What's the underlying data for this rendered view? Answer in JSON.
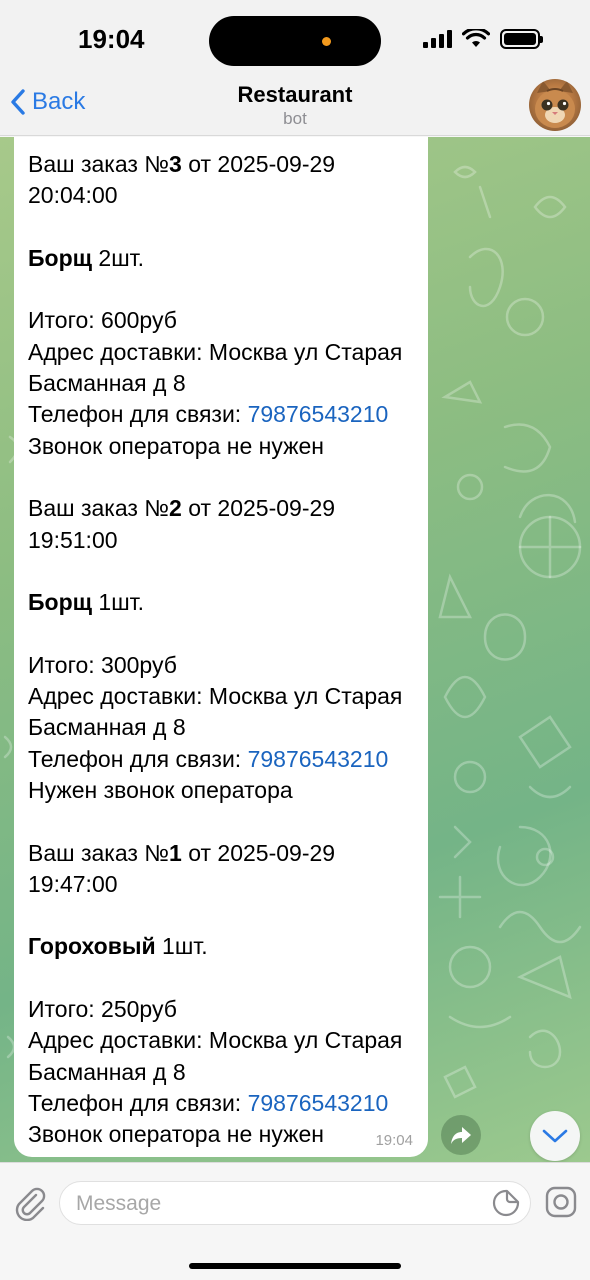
{
  "status_bar": {
    "time": "19:04"
  },
  "header": {
    "back_label": "Back",
    "title": "Restaurant",
    "subtitle": "bot",
    "avatar": "cat-avatar"
  },
  "message": {
    "orders": [
      {
        "prefix": "Ваш заказ №",
        "number": "3",
        "date_suffix": " от 2025-09-29",
        "time": "20:04:00",
        "dish": "Борщ",
        "qty": " 2шт.",
        "total": "Итого: 600руб",
        "address_1": "Адрес доставки: Москва ул Старая",
        "address_2": "Басманная д 8",
        "phone_label": "Телефон для связи: ",
        "phone": "79876543210",
        "operator_note": "Звонок оператора не нужен"
      },
      {
        "prefix": "Ваш заказ №",
        "number": "2",
        "date_suffix": " от 2025-09-29",
        "time": "19:51:00",
        "dish": "Борщ",
        "qty": " 1шт.",
        "total": "Итого: 300руб",
        "address_1": "Адрес доставки: Москва ул Старая",
        "address_2": "Басманная д 8",
        "phone_label": "Телефон для связи: ",
        "phone": "79876543210",
        "operator_note": "Нужен звонок оператора"
      },
      {
        "prefix": "Ваш заказ №",
        "number": "1",
        "date_suffix": " от 2025-09-29",
        "time": "19:47:00",
        "dish": "Гороховый",
        "qty": " 1шт.",
        "total": "Итого: 250руб",
        "address_1": "Адрес доставки: Москва ул Старая",
        "address_2": "Басманная д 8",
        "phone_label": "Телефон для связи: ",
        "phone": "79876543210",
        "operator_note": "Звонок оператора не нужен"
      }
    ],
    "timestamp": "19:04"
  },
  "input": {
    "placeholder": "Message"
  },
  "icons": {
    "back": "chevron-left-icon",
    "forward": "forward-arrow-icon",
    "scroll_down": "chevron-down-icon",
    "attach": "paperclip-icon",
    "sticker": "sticker-icon",
    "camera": "instagram-camera-icon"
  },
  "colors": {
    "accent": "#2a7ae4",
    "link": "#1a64bf",
    "wallpaper": "#8dbd82"
  }
}
